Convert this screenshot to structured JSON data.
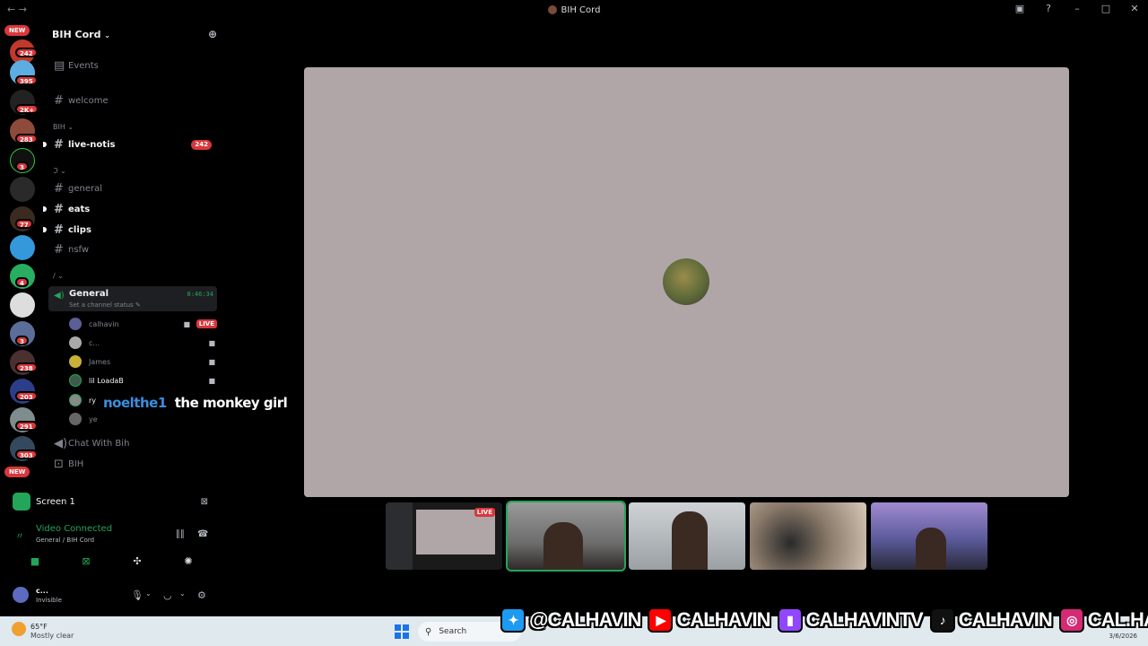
{
  "window": {
    "title": "BIH Cord"
  },
  "servers": {
    "badges": [
      "NEW",
      "242",
      "395",
      "2K+",
      "283",
      "3",
      "77",
      "4",
      "3",
      "238",
      "203",
      "291",
      "303",
      "NEW"
    ]
  },
  "guild": {
    "name": "BIH Cord"
  },
  "channels": {
    "events": "Events",
    "welcome": "welcome",
    "cat_bih": "BIH",
    "live_notis": "live-notis",
    "live_notis_badge": "242",
    "cat_2": "ℑ",
    "general": "general",
    "eats": "eats",
    "clips": "clips",
    "nsfw": "nsfw",
    "cat_3": "/",
    "chat_with_bih": "Chat With Bih",
    "bih": "BIH"
  },
  "voice": {
    "channel_name": "General",
    "channel_status": "Set a channel status",
    "timer": "8:46:34",
    "live_label": "LIVE",
    "users": [
      "calhavin",
      "c...",
      "James",
      "lil LoadaB",
      "ry",
      "ye"
    ]
  },
  "overlay": {
    "user": "noelthe1",
    "message": "the monkey girl"
  },
  "panel": {
    "screen_label": "Screen 1",
    "vc_title": "Video Connected",
    "vc_sub": "General / BIH Cord",
    "user_name": "c...",
    "user_status": "Invisible"
  },
  "tiles": {
    "live_label": "LIVE"
  },
  "taskbar": {
    "temp": "65°F",
    "weather": "Mostly clear",
    "search": "Search",
    "date": "3/6/2026"
  },
  "socials": {
    "twitter": "@CALHAVIN",
    "youtube": "CALHAVIN",
    "twitch": "CALHAVINTV",
    "tiktok": "CALHAVIN",
    "instagram": "CAL.HAVIN"
  },
  "colors": {
    "green": "#23a55a",
    "red": "#da373c",
    "stage_bg": "#b0a6a8",
    "overlay_user": "#3b8ee0"
  }
}
